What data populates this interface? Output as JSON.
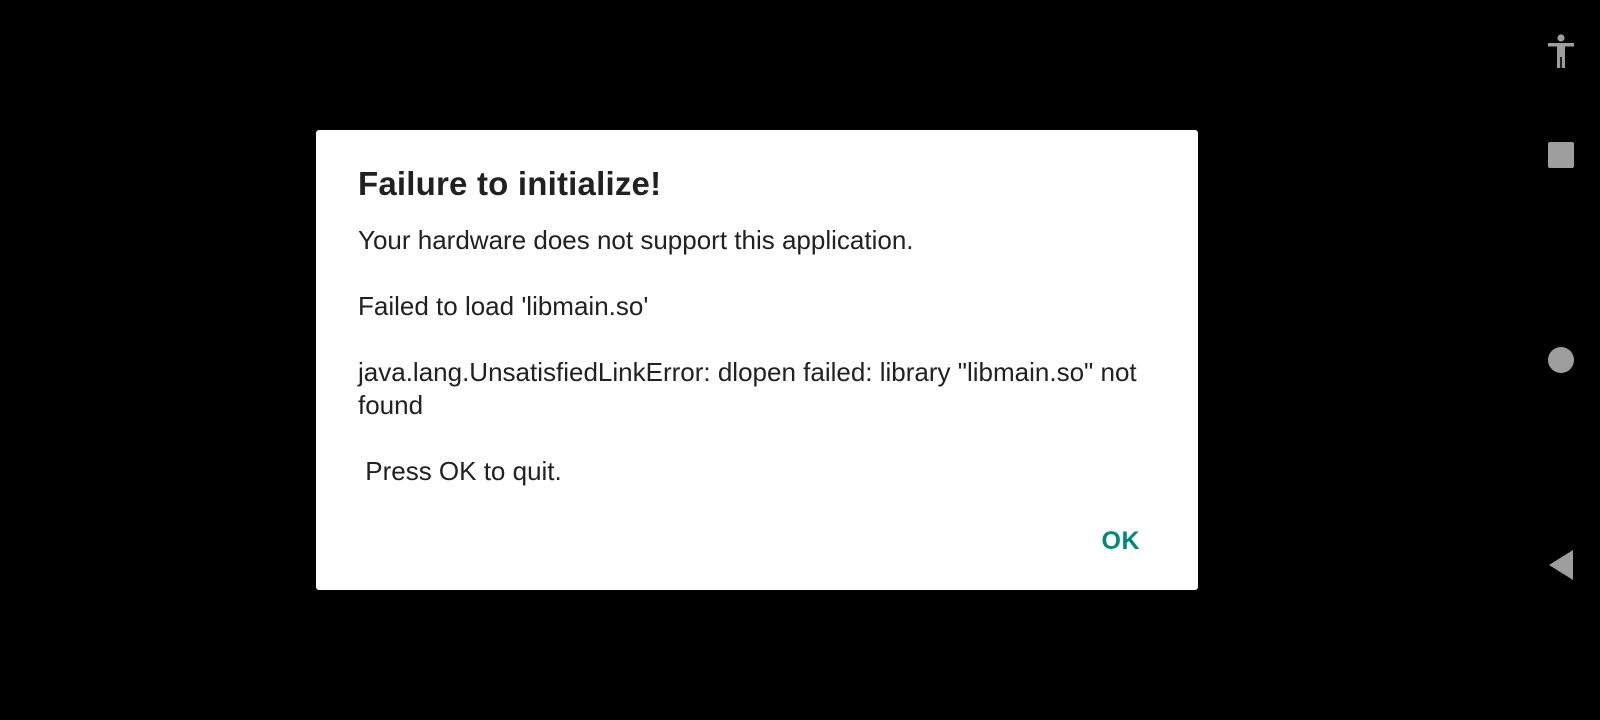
{
  "dialog": {
    "title": "Failure to initialize!",
    "message_lines": [
      "Your hardware does not support this application.",
      "Failed to load 'libmain.so'",
      "java.lang.UnsatisfiedLinkError: dlopen failed: library \"libmain.so\" not found",
      " Press OK to quit."
    ],
    "ok_label": "OK"
  },
  "navbar": {
    "items": [
      {
        "icon": "accessibility-icon"
      },
      {
        "icon": "recents-square-icon"
      },
      {
        "icon": "home-circle-icon"
      },
      {
        "icon": "back-triangle-icon"
      }
    ]
  },
  "colors": {
    "background": "#000000",
    "dialog_bg": "#ffffff",
    "text": "#212121",
    "accent": "#00897b",
    "nav_icon": "#9e9e9e"
  }
}
